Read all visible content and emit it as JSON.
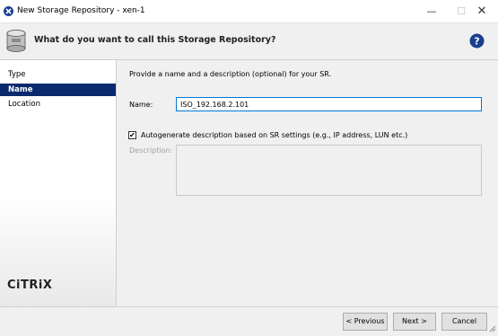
{
  "window": {
    "title": "New Storage Repository - xen-1",
    "minimize": "—",
    "maximize": "☐",
    "close": "✕"
  },
  "header": {
    "title": "What do you want to call this Storage Repository?"
  },
  "nav": {
    "items": [
      {
        "label": "Type"
      },
      {
        "label": "Name"
      },
      {
        "label": "Location"
      }
    ],
    "selected": "Name",
    "logo": "CiTRiX"
  },
  "form": {
    "intro": "Provide a name and a description (optional) for your SR.",
    "name_label": "Name:",
    "name_value": "ISO_192.168.2.101",
    "autogen_label": "Autogenerate description based on SR settings (e.g., IP address, LUN etc.)",
    "autogen_checked": true,
    "check_mark": "✔",
    "description_label": "Description:",
    "description_value": ""
  },
  "footer": {
    "previous": "< Previous",
    "next": "Next >",
    "cancel": "Cancel"
  },
  "colors": {
    "nav_selected": "#0b2a6e",
    "input_focus": "#0078d7",
    "help_icon": "#1a3f8f"
  }
}
